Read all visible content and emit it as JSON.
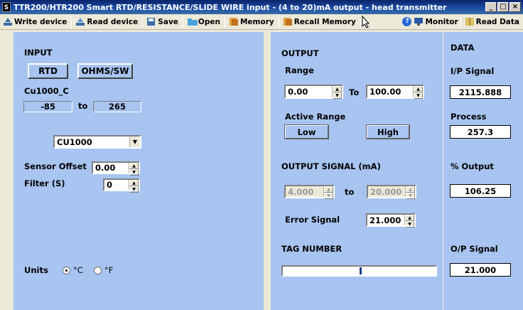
{
  "window": {
    "title": "TTR200/HTR200 Smart RTD/RESISTANCE/SLIDE WIRE input - (4 to 20)mA output - head transmitter",
    "app_icon": "S",
    "min": "_",
    "max": "□",
    "close": "×"
  },
  "toolbar": {
    "write": "Write device",
    "read": "Read device",
    "save": "Save",
    "open": "Open",
    "memory": "Memory",
    "recall": "Recall Memory",
    "help": "?",
    "monitor": "Monitor",
    "read_data": "Read Data"
  },
  "input": {
    "heading": "INPUT",
    "rtd_label": "RTD",
    "ohms_label": "OHMS/SW",
    "sensor_name": "Cu1000_C",
    "range_low": "-85",
    "range_to": "to",
    "range_high": "265",
    "sensor_select": "CU1000",
    "offset_label": "Sensor Offset",
    "offset_value": "0.00",
    "filter_label": "Filter (S)",
    "filter_value": "0",
    "units_label": "Units",
    "unit_c": "°C",
    "unit_f": "°F",
    "units_selected": "C"
  },
  "output": {
    "heading": "OUTPUT",
    "range_label": "Range",
    "range_from": "0.00",
    "range_to_label": "To",
    "range_to": "100.00",
    "active_range_label": "Active Range",
    "low_label": "Low",
    "high_label": "High",
    "signal_heading": "OUTPUT SIGNAL (mA)",
    "signal_from": "4.000",
    "signal_to_label": "to",
    "signal_to": "20.000",
    "error_label": "Error Signal",
    "error_value": "21.000",
    "tag_label": "TAG NUMBER",
    "tag_value": ""
  },
  "data": {
    "heading": "DATA",
    "ip_label": "I/P  Signal",
    "ip_value": "2115.888",
    "process_label": "Process",
    "process_value": "257.3",
    "pct_label": "% Output",
    "pct_value": "106.25",
    "op_label": "O/P Signal",
    "op_value": "21.000"
  },
  "colors": {
    "panel": "#a8c4f0",
    "titlebar": "#0a246a",
    "chrome": "#ece9d8"
  }
}
